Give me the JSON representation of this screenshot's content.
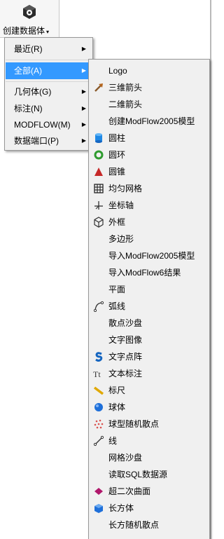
{
  "ribbon": {
    "button_label": "创建数据体",
    "dropdown_arrow": "▾",
    "icon": "cube-gear-icon"
  },
  "primary_menu": {
    "items": [
      {
        "label": "最近(R)",
        "has_submenu": true,
        "active": false
      },
      {
        "label": "全部(A)",
        "has_submenu": true,
        "active": true
      },
      {
        "label": "几何体(G)",
        "has_submenu": true,
        "active": false
      },
      {
        "label": "标注(N)",
        "has_submenu": true,
        "active": false
      },
      {
        "label": "MODFLOW(M)",
        "has_submenu": true,
        "active": false
      },
      {
        "label": "数据端口(P)",
        "has_submenu": true,
        "active": false
      }
    ],
    "submenu_arrow": "▶"
  },
  "submenu": {
    "items": [
      {
        "label": "Logo",
        "icon": ""
      },
      {
        "label": "三维箭头",
        "icon": "arrow-3d-icon"
      },
      {
        "label": "二维箭头",
        "icon": ""
      },
      {
        "label": "创建ModFlow2005模型",
        "icon": ""
      },
      {
        "label": "圆柱",
        "icon": "cylinder-icon"
      },
      {
        "label": "圆环",
        "icon": "torus-icon"
      },
      {
        "label": "圆锥",
        "icon": "cone-icon"
      },
      {
        "label": "均匀网格",
        "icon": "grid-icon"
      },
      {
        "label": "坐标轴",
        "icon": "axes-icon"
      },
      {
        "label": "外框",
        "icon": "bounding-box-icon"
      },
      {
        "label": "多边形",
        "icon": ""
      },
      {
        "label": "导入ModFlow2005模型",
        "icon": ""
      },
      {
        "label": "导入ModFlow6结果",
        "icon": ""
      },
      {
        "label": "平面",
        "icon": ""
      },
      {
        "label": "弧线",
        "icon": "arc-icon"
      },
      {
        "label": "散点沙盘",
        "icon": ""
      },
      {
        "label": "文字图像",
        "icon": ""
      },
      {
        "label": "文字点阵",
        "icon": "text-lattice-icon"
      },
      {
        "label": "文本标注",
        "icon": "text-annotation-icon"
      },
      {
        "label": "标尺",
        "icon": "ruler-icon"
      },
      {
        "label": "球体",
        "icon": "sphere-icon"
      },
      {
        "label": "球型随机散点",
        "icon": "scatter-sphere-icon"
      },
      {
        "label": "线",
        "icon": "line-icon"
      },
      {
        "label": "网格沙盘",
        "icon": ""
      },
      {
        "label": "读取SQL数据源",
        "icon": ""
      },
      {
        "label": "超二次曲面",
        "icon": "superquadric-icon"
      },
      {
        "label": "长方体",
        "icon": "box-icon"
      },
      {
        "label": "长方随机散点",
        "icon": ""
      }
    ]
  },
  "colors": {
    "highlight": "#3399ff",
    "menu_bg": "#f0f0f0",
    "menu_border": "#979797"
  }
}
